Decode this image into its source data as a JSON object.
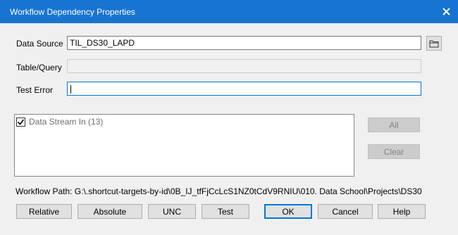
{
  "window": {
    "title": "Workflow Dependency Properties",
    "close_icon": "close-icon"
  },
  "form": {
    "data_source_label": "Data Source",
    "data_source_value": "TIL_DS30_LAPD",
    "table_query_label": "Table/Query",
    "table_query_value": "",
    "test_error_label": "Test Error",
    "test_error_value": "",
    "browse_icon": "folder-icon"
  },
  "list": {
    "items": [
      {
        "label": "Data Stream In (13)",
        "checked": true
      }
    ]
  },
  "side_buttons": {
    "all_label": "All",
    "clear_label": "Clear"
  },
  "workflow_path": "Workflow Path: G:\\.shortcut-targets-by-id\\0B_IJ_tfFjCcLcS1NZ0tCdV9RNIU\\010. Data School\\Projects\\DS30",
  "bottom_buttons": {
    "relative": "Relative",
    "absolute": "Absolute",
    "unc": "UNC",
    "test": "Test",
    "ok": "OK",
    "cancel": "Cancel",
    "help": "Help"
  },
  "colors": {
    "titlebar": "#1774d1",
    "focus_border": "#0078d7"
  }
}
